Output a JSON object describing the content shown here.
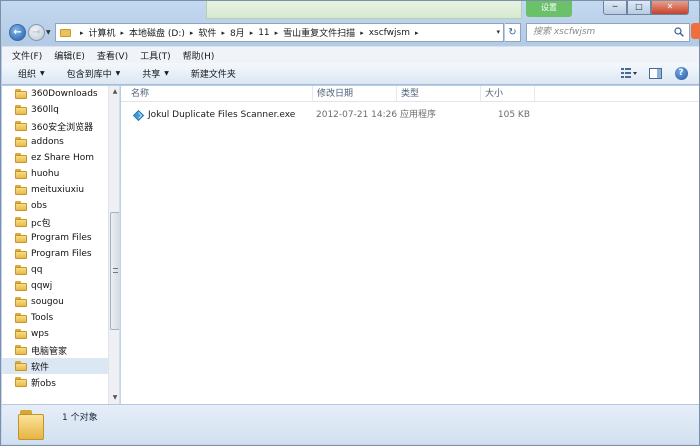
{
  "title_bar": {
    "banner_button": "设置"
  },
  "window_controls": {
    "minimize": "─",
    "maximize": "□",
    "close": "✕"
  },
  "address_bar": {
    "breadcrumbs": [
      "计算机",
      "本地磁盘 (D:)",
      "软件",
      "8月",
      "11",
      "雪山重复文件扫描",
      "xscfwjsm"
    ],
    "separator": "▸",
    "dropdown": "▾"
  },
  "search": {
    "placeholder": "搜索 xscfwjsm"
  },
  "menu": {
    "items": [
      "文件(F)",
      "编辑(E)",
      "查看(V)",
      "工具(T)",
      "帮助(H)"
    ]
  },
  "toolbar": {
    "organize": "组织",
    "include_in_library": "包含到库中",
    "share": "共享",
    "new_folder": "新建文件夹",
    "caret": "▼"
  },
  "nav_pane": {
    "items": [
      "360Downloads",
      "360llq",
      "360安全浏览器",
      "addons",
      "ez Share Hom",
      "huohu",
      "meituxiuxiu",
      "obs",
      "pc包",
      "Program Files",
      "Program Files",
      "qq",
      "qqwj",
      "sougou",
      "Tools",
      "wps",
      "电脑管家",
      "软件",
      "新obs"
    ],
    "selected": "软件"
  },
  "columns": {
    "name": "名称",
    "modified": "修改日期",
    "type": "类型",
    "size": "大小"
  },
  "files": [
    {
      "name": "Jokul Duplicate Files Scanner.exe",
      "modified": "2012-07-21 14:26",
      "type": "应用程序",
      "size": "105 KB"
    }
  ],
  "status": {
    "item_count": "1 个对象"
  },
  "colors": {
    "accent": "#3463a5",
    "folder": "#e8b94a",
    "selection": "#dce7f4"
  }
}
